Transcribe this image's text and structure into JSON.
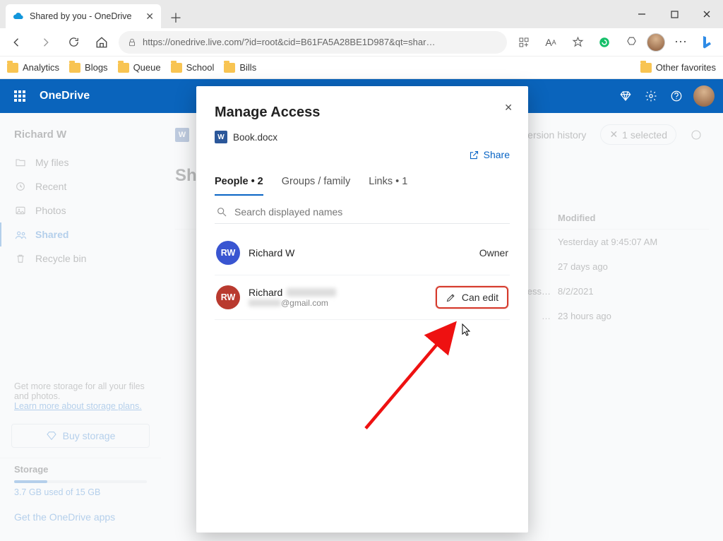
{
  "browser": {
    "tab_title": "Shared by you - OneDrive",
    "url_display": "https://onedrive.live.com/?id=root&cid=B61FA5A28BE1D987&qt=shar…",
    "bookmarks": [
      "Analytics",
      "Blogs",
      "Queue",
      "School",
      "Bills"
    ],
    "other_favorites": "Other favorites"
  },
  "header": {
    "app": "OneDrive"
  },
  "sidebar": {
    "user": "Richard W",
    "items": [
      {
        "label": "My files"
      },
      {
        "label": "Recent"
      },
      {
        "label": "Photos"
      },
      {
        "label": "Shared"
      },
      {
        "label": "Recycle bin"
      }
    ],
    "promo_line1": "Get more storage for all your files and photos.",
    "promo_link": "Learn more about storage plans.",
    "buy_label": "Buy storage",
    "storage_heading": "Storage",
    "storage_text": "3.7 GB used of 15 GB",
    "storage_percent": 25,
    "apps_link": "Get the OneDrive apps"
  },
  "actionbar": {
    "version_history": "Version history",
    "selected": "1 selected"
  },
  "main": {
    "section_title": "Sh",
    "columns": {
      "modified": "Modified"
    },
    "rows": [
      {
        "modified": "Yesterday at 9:45:07 AM"
      },
      {
        "modified": "27 days ago"
      },
      {
        "shared": "ofess…",
        "modified": "8/2/2021"
      },
      {
        "more": "…",
        "modified": "23 hours ago"
      }
    ]
  },
  "modal": {
    "title": "Manage Access",
    "file": "Book.docx",
    "share": "Share",
    "tabs": {
      "people": "People • 2",
      "groups": "Groups / family",
      "links": "Links • 1"
    },
    "search_placeholder": "Search displayed names",
    "people": [
      {
        "initials": "RW",
        "name": "Richard W",
        "role": "Owner"
      },
      {
        "initials": "RW",
        "name": "Richard",
        "email_suffix": "@gmail.com",
        "perm": "Can edit"
      }
    ]
  }
}
